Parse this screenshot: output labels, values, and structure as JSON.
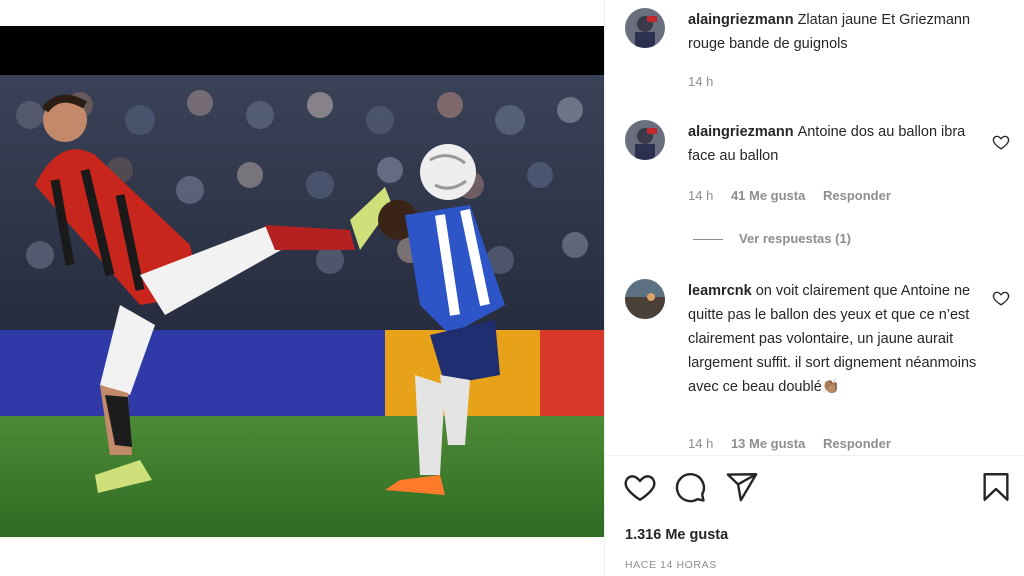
{
  "post": {
    "likes": "1.316 Me gusta",
    "time_ago": "HACE 14 HORAS"
  },
  "comments": [
    {
      "username": "alaingriezmann",
      "text": "Zlatan jaune Et Griezmann rouge bande de guignols",
      "time": "14 h"
    },
    {
      "username": "alaingriezmann",
      "text": "Antoine dos au ballon ibra face au ballon",
      "time": "14 h",
      "likes": "41 Me gusta",
      "reply": "Responder",
      "view_replies": "Ver respuestas (1)"
    },
    {
      "username": "leamrcnk",
      "text": "on voit clairement que Antoine ne quitte pas le ballon des yeux et que ce n’est clairement pas volontaire, un jaune aurait largement suffit. il sort dignement néanmoins avec ce beau doublé👏🏽",
      "time": "14 h",
      "likes": "13 Me gusta",
      "reply": "Responder"
    }
  ],
  "icons": {
    "like": "heart-icon",
    "comment": "comment-icon",
    "share": "share-icon",
    "save": "bookmark-icon"
  },
  "colors": {
    "text": "#262626",
    "muted": "#8e8e8e",
    "divider": "#efefef"
  }
}
